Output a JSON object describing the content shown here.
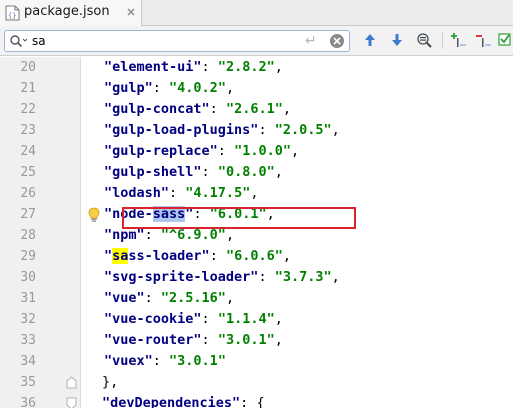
{
  "tab": {
    "label": "package.json"
  },
  "search": {
    "value": "sa"
  },
  "colors": {
    "key": "#000080",
    "string": "#008000",
    "highlight": "#aec5ec",
    "match": "#ffff00",
    "annotation": "#d9232f"
  },
  "lines": [
    {
      "num": "20",
      "key": "\"element-ui\"",
      "value": "\"2.8.2\"",
      "sep": ": ",
      "end": ","
    },
    {
      "num": "21",
      "key": "\"gulp\"",
      "value": "\"4.0.2\"",
      "sep": ": ",
      "end": ","
    },
    {
      "num": "22",
      "key": "\"gulp-concat\"",
      "value": "\"2.6.1\"",
      "sep": ": ",
      "end": ","
    },
    {
      "num": "23",
      "key": "\"gulp-load-plugins\"",
      "value": "\"2.0.5\"",
      "sep": ": ",
      "end": ","
    },
    {
      "num": "24",
      "key": "\"gulp-replace\"",
      "value": "\"1.0.0\"",
      "sep": ": ",
      "end": ","
    },
    {
      "num": "25",
      "key": "\"gulp-shell\"",
      "value": "\"0.8.0\"",
      "sep": ": ",
      "end": ","
    },
    {
      "num": "26",
      "key": "\"lodash\"",
      "value": "\"4.17.5\"",
      "sep": ": ",
      "end": ","
    },
    {
      "num": "27",
      "key_pre": "\"node-",
      "key_match": "sass",
      "key_post": "\"",
      "value": "\"6.0.1\"",
      "sep": ": ",
      "end": ","
    },
    {
      "num": "28",
      "key": "\"npm\"",
      "value": "\"^6.9.0\"",
      "sep": ": ",
      "end": ","
    },
    {
      "num": "29",
      "key_q": "\"",
      "key_match": "sa",
      "key_post": "ss-loader\"",
      "value": "\"6.0.6\"",
      "sep": ": ",
      "end": ","
    },
    {
      "num": "30",
      "key": "\"svg-sprite-loader\"",
      "value": "\"3.7.3\"",
      "sep": ": ",
      "end": ","
    },
    {
      "num": "31",
      "key": "\"vue\"",
      "value": "\"2.5.16\"",
      "sep": ": ",
      "end": ","
    },
    {
      "num": "32",
      "key": "\"vue-cookie\"",
      "value": "\"1.1.4\"",
      "sep": ": ",
      "end": ","
    },
    {
      "num": "33",
      "key": "\"vue-router\"",
      "value": "\"3.0.1\"",
      "sep": ": ",
      "end": ","
    },
    {
      "num": "34",
      "key": "\"vuex\"",
      "value": "\"3.0.1\"",
      "sep": ": ",
      "end": ""
    },
    {
      "num": "35",
      "text": "},"
    },
    {
      "num": "36",
      "key": "\"devDependencies\"",
      "sep": ": ",
      "end": "{"
    }
  ]
}
